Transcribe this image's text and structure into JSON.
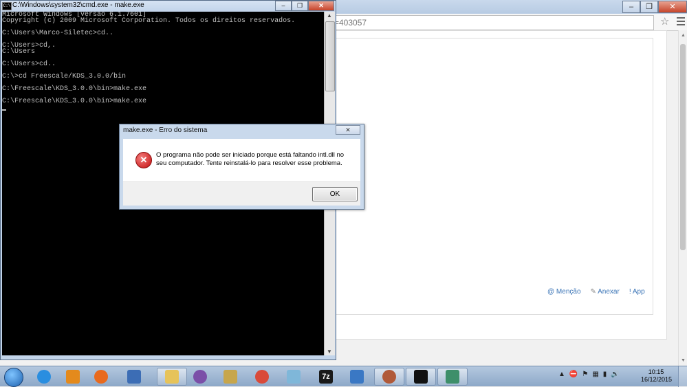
{
  "browser": {
    "url_fragment": "=403057",
    "star_icon": "star-icon",
    "composer_actions": {
      "mention": "@ Menção",
      "attach": "Anexar",
      "app": "! App"
    }
  },
  "cmd": {
    "title": "C:\\Windows\\system32\\cmd.exe - make.exe",
    "lines": [
      "Microsoft Windows [versão 6.1.7601]",
      "Copyright (c) 2009 Microsoft Corporation. Todos os direitos reservados.",
      "",
      "C:\\Users\\Marco-Siletec>cd..",
      "",
      "C:\\Users>cd,.",
      "C:\\Users",
      "",
      "C:\\Users>cd..",
      "",
      "C:\\>cd Freescale/KDS_3.0.0/bin",
      "",
      "C:\\Freescale\\KDS_3.0.0\\bin>make.exe",
      "",
      "C:\\Freescale\\KDS_3.0.0\\bin>make.exe"
    ],
    "icon_label": "C:\\"
  },
  "dialog": {
    "title": "make.exe - Erro do sistema",
    "message": "O programa não pode ser iniciado porque está faltando intl.dll no seu computador. Tente reinstalá-lo para resolver esse problema.",
    "ok_label": "OK"
  },
  "taskbar": {
    "time": "10:15",
    "date": "16/12/2015",
    "seven_zip_label": "7z",
    "apps": [
      {
        "name": "internet-explorer",
        "color": "#2a8ee0"
      },
      {
        "name": "media-player",
        "color": "#e48a1c"
      },
      {
        "name": "firefox",
        "color": "#e86a1e"
      },
      {
        "name": "thunderbird",
        "color": "#3c6db5"
      },
      {
        "name": "file-explorer",
        "color": "#e6c35a"
      },
      {
        "name": "viber",
        "color": "#7b4fa8"
      },
      {
        "name": "app-stack",
        "color": "#c7a64c"
      },
      {
        "name": "chrome",
        "color": "#d94a3a"
      },
      {
        "name": "cube-app",
        "color": "#7fb7d9"
      },
      {
        "name": "7zip",
        "color": "#1a1a1a"
      },
      {
        "name": "installer",
        "color": "#3a78c4"
      },
      {
        "name": "globe-app",
        "color": "#b05a3a"
      },
      {
        "name": "cmd",
        "color": "#111111"
      },
      {
        "name": "window-app",
        "color": "#3e8f6a"
      }
    ]
  }
}
